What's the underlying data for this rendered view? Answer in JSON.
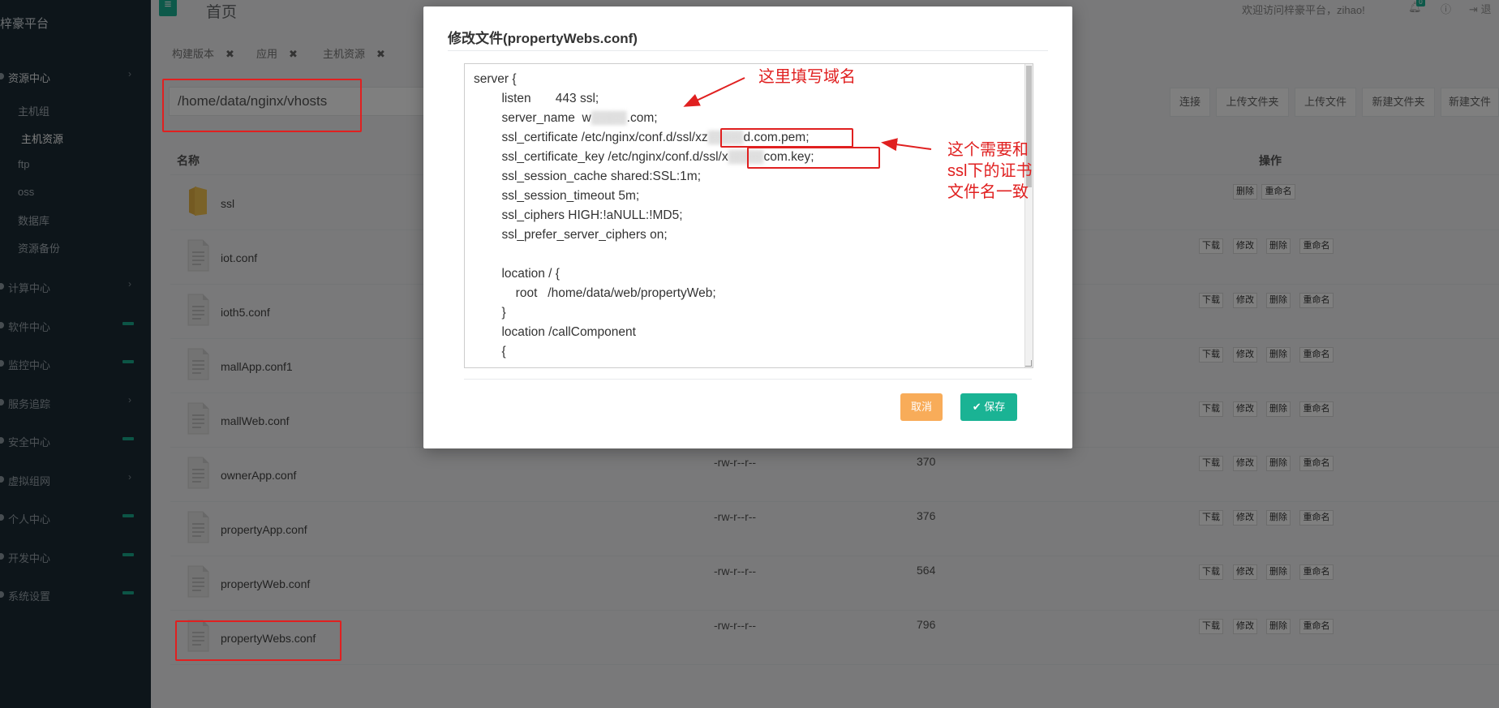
{
  "sidebar": {
    "brand": "梓豪平台",
    "sections": [
      {
        "label": "资源中心",
        "marker": "chevron",
        "active": true
      },
      {
        "label": "计算中心",
        "marker": "chevron"
      },
      {
        "label": "软件中心",
        "marker": "pill"
      },
      {
        "label": "监控中心",
        "marker": "pill"
      },
      {
        "label": "服务追踪",
        "marker": "chevron"
      },
      {
        "label": "安全中心",
        "marker": "pill"
      },
      {
        "label": "虚拟组网",
        "marker": "chevron"
      },
      {
        "label": "个人中心",
        "marker": "pill"
      },
      {
        "label": "开发中心",
        "marker": "pill"
      },
      {
        "label": "系统设置",
        "marker": "pill"
      }
    ],
    "sub_items": [
      {
        "label": "主机组"
      },
      {
        "label": "主机资源",
        "active": true
      },
      {
        "label": "ftp"
      },
      {
        "label": "oss"
      },
      {
        "label": "数据库"
      },
      {
        "label": "资源备份"
      }
    ]
  },
  "topbar": {
    "page_title": "首页",
    "welcome": "欢迎访问梓豪平台，zihao!",
    "notification_count": "0",
    "logout": "退"
  },
  "tabs": [
    {
      "label": "构建版本"
    },
    {
      "label": "应用"
    },
    {
      "label": "主机资源"
    }
  ],
  "path": {
    "value": "/home/data/nginx/vhosts"
  },
  "toolbar": {
    "connect": "连接",
    "upload_folder": "上传文件夹",
    "upload_file": "上传文件",
    "new_folder": "新建文件夹",
    "new_file": "新建文件"
  },
  "table": {
    "col_name": "名称",
    "col_ops": "操作",
    "actions": {
      "download": "下载",
      "edit": "修改",
      "delete": "删除",
      "rename": "重命名"
    },
    "rows": [
      {
        "name": "ssl",
        "type": "folder",
        "perm": "",
        "size": ""
      },
      {
        "name": "iot.conf",
        "type": "file",
        "perm": "",
        "size": ""
      },
      {
        "name": "ioth5.conf",
        "type": "file",
        "perm": "",
        "size": ""
      },
      {
        "name": "mallApp.conf1",
        "type": "file",
        "perm": "",
        "size": ""
      },
      {
        "name": "mallWeb.conf",
        "type": "file",
        "perm": "",
        "size": ""
      },
      {
        "name": "ownerApp.conf",
        "type": "file",
        "perm": "-rw-r--r--",
        "size": "370"
      },
      {
        "name": "propertyApp.conf",
        "type": "file",
        "perm": "-rw-r--r--",
        "size": "376"
      },
      {
        "name": "propertyWeb.conf",
        "type": "file",
        "perm": "-rw-r--r--",
        "size": "564"
      },
      {
        "name": "propertyWebs.conf",
        "type": "file",
        "perm": "-rw-r--r--",
        "size": "796"
      }
    ]
  },
  "modal": {
    "title": "修改文件(propertyWebs.conf)",
    "cancel": "取消",
    "save": "保存",
    "code_lines": [
      "server {",
      "        listen       443 ssl;",
      "        server_name  w",
      "        ssl_certificate /etc/nginx/conf.d/ssl/xz",
      "        ssl_certificate_key /etc/nginx/conf.d/ssl/x",
      "        ssl_session_cache shared:SSL:1m;",
      "        ssl_session_timeout 5m;",
      "        ssl_ciphers HIGH:!aNULL:!MD5;",
      "        ssl_prefer_server_ciphers on;",
      "",
      "        location / {",
      "            root   /home/data/web/propertyWeb;",
      "        }",
      "        location /callComponent",
      "        {"
    ],
    "code_line_tails": {
      "server_name": ".com;",
      "ssl_certificate": "d.com.pem;",
      "ssl_certificate_key": "com.key;"
    }
  },
  "annotations": {
    "domain_note": "这里填写域名",
    "cert_note": "这个需要和ssl下的证书文件名一致"
  },
  "colors": {
    "accent": "#1ab394",
    "warning": "#f8ac59",
    "annotation": "#e02020",
    "sidebar_bg": "#1a2b35"
  }
}
